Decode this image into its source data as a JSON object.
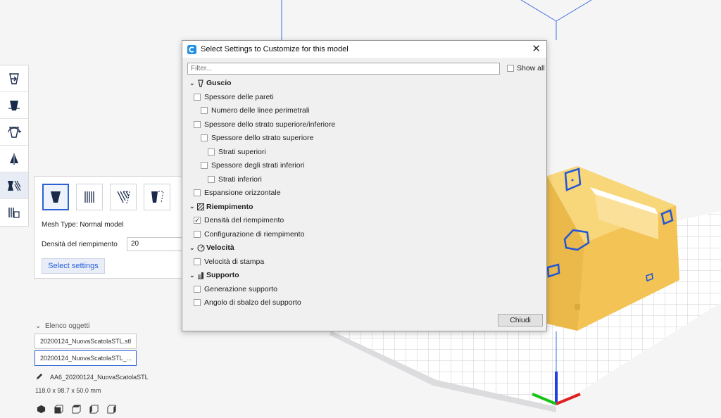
{
  "dialog": {
    "title": "Select Settings to Customize for this model",
    "filter_placeholder": "Filter...",
    "show_all_label": "Show all",
    "close_button": "Chiudi",
    "categories": [
      {
        "label": "Guscio",
        "items": [
          {
            "label": "Spessore delle pareti",
            "checked": false,
            "level": 0
          },
          {
            "label": "Numero delle linee perimetrali",
            "checked": false,
            "level": 1
          },
          {
            "label": "Spessore dello strato superiore/inferiore",
            "checked": false,
            "level": 0
          },
          {
            "label": "Spessore dello strato superiore",
            "checked": false,
            "level": 1
          },
          {
            "label": "Strati superiori",
            "checked": false,
            "level": 2
          },
          {
            "label": "Spessore degli strati inferiori",
            "checked": false,
            "level": 1
          },
          {
            "label": "Strati inferiori",
            "checked": false,
            "level": 2
          },
          {
            "label": "Espansione orizzontale",
            "checked": false,
            "level": 0
          }
        ]
      },
      {
        "label": "Riempimento",
        "items": [
          {
            "label": "Densità del riempimento",
            "checked": true,
            "level": 0
          },
          {
            "label": "Configurazione di riempimento",
            "checked": false,
            "level": 0
          }
        ]
      },
      {
        "label": "Velocità",
        "items": [
          {
            "label": "Velocità di stampa",
            "checked": false,
            "level": 0
          }
        ]
      },
      {
        "label": "Supporto",
        "items": [
          {
            "label": "Generazione supporto",
            "checked": false,
            "level": 0
          },
          {
            "label": "Angolo di sbalzo del supporto",
            "checked": false,
            "level": 0
          }
        ]
      }
    ]
  },
  "panel": {
    "mesh_type": "Mesh Type: Normal model",
    "density_label": "Densità del riempimento",
    "density_value": "20",
    "select_button": "Select settings"
  },
  "objects": {
    "header": "Elenco oggetti",
    "items": [
      "20200124_NuovaScatolaSTL.stl",
      "20200124_NuovaScatolaSTL_..."
    ]
  },
  "model": {
    "name": "AA6_20200124_NuovaScatolaSTL",
    "dimensions": "118.0 x 98.7 x 50.0 mm"
  },
  "colors": {
    "accent": "#2a61d6",
    "model": "#f4c85a",
    "plate_grid": "#cfcfd2"
  }
}
